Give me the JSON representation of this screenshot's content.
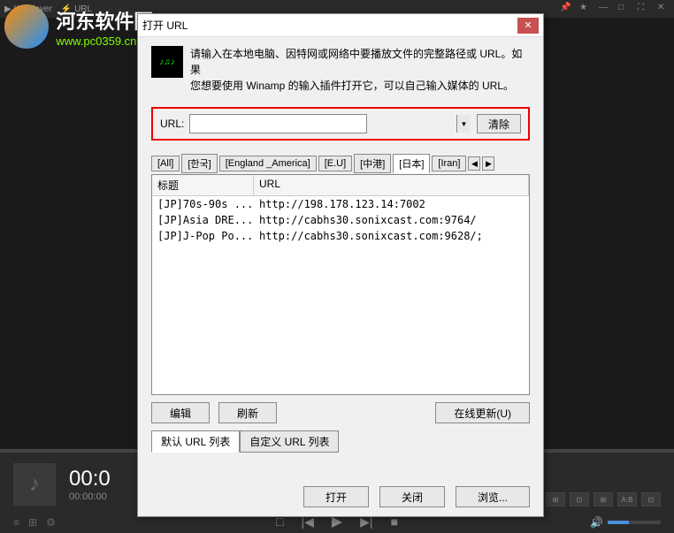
{
  "topbar": {
    "app_name": "KMPlayer",
    "url_label": "URL"
  },
  "watermark": {
    "title": "河东软件园",
    "url": "www.pc0359.cn"
  },
  "player": {
    "time_big": "00:0",
    "time_small": "00:00:00"
  },
  "dialog": {
    "title": "打开 URL",
    "close": "✕",
    "info_line1": "请输入在本地电脑、因特网或网络中要播放文件的完整路径或 URL。如果",
    "info_line2": "您想要使用 Winamp 的输入插件打开它，可以自己输入媒体的 URL。",
    "url_label": "URL:",
    "url_value": "",
    "clear": "清除",
    "tabs": [
      "[All]",
      "[한국]",
      "[England _America]",
      "[E.U]",
      "[中港]",
      "[日本]",
      "[Iran]"
    ],
    "active_tab": 5,
    "list_headers": {
      "title": "标题",
      "url": "URL"
    },
    "list_rows": [
      {
        "title": "[JP]70s-90s ...",
        "url": "http://198.178.123.14:7002"
      },
      {
        "title": "[JP]Asia DRE...",
        "url": "http://cabhs30.sonixcast.com:9764/"
      },
      {
        "title": "[JP]J-Pop Po...",
        "url": "http://cabhs30.sonixcast.com:9628/;"
      }
    ],
    "edit_btn": "编辑",
    "refresh_btn": "刷新",
    "update_btn": "在线更新(U)",
    "subtabs": [
      "默认 URL 列表",
      "自定义 URL 列表"
    ],
    "active_subtab": 0,
    "open_btn": "打开",
    "close_btn": "关闭",
    "browse_btn": "浏览..."
  }
}
